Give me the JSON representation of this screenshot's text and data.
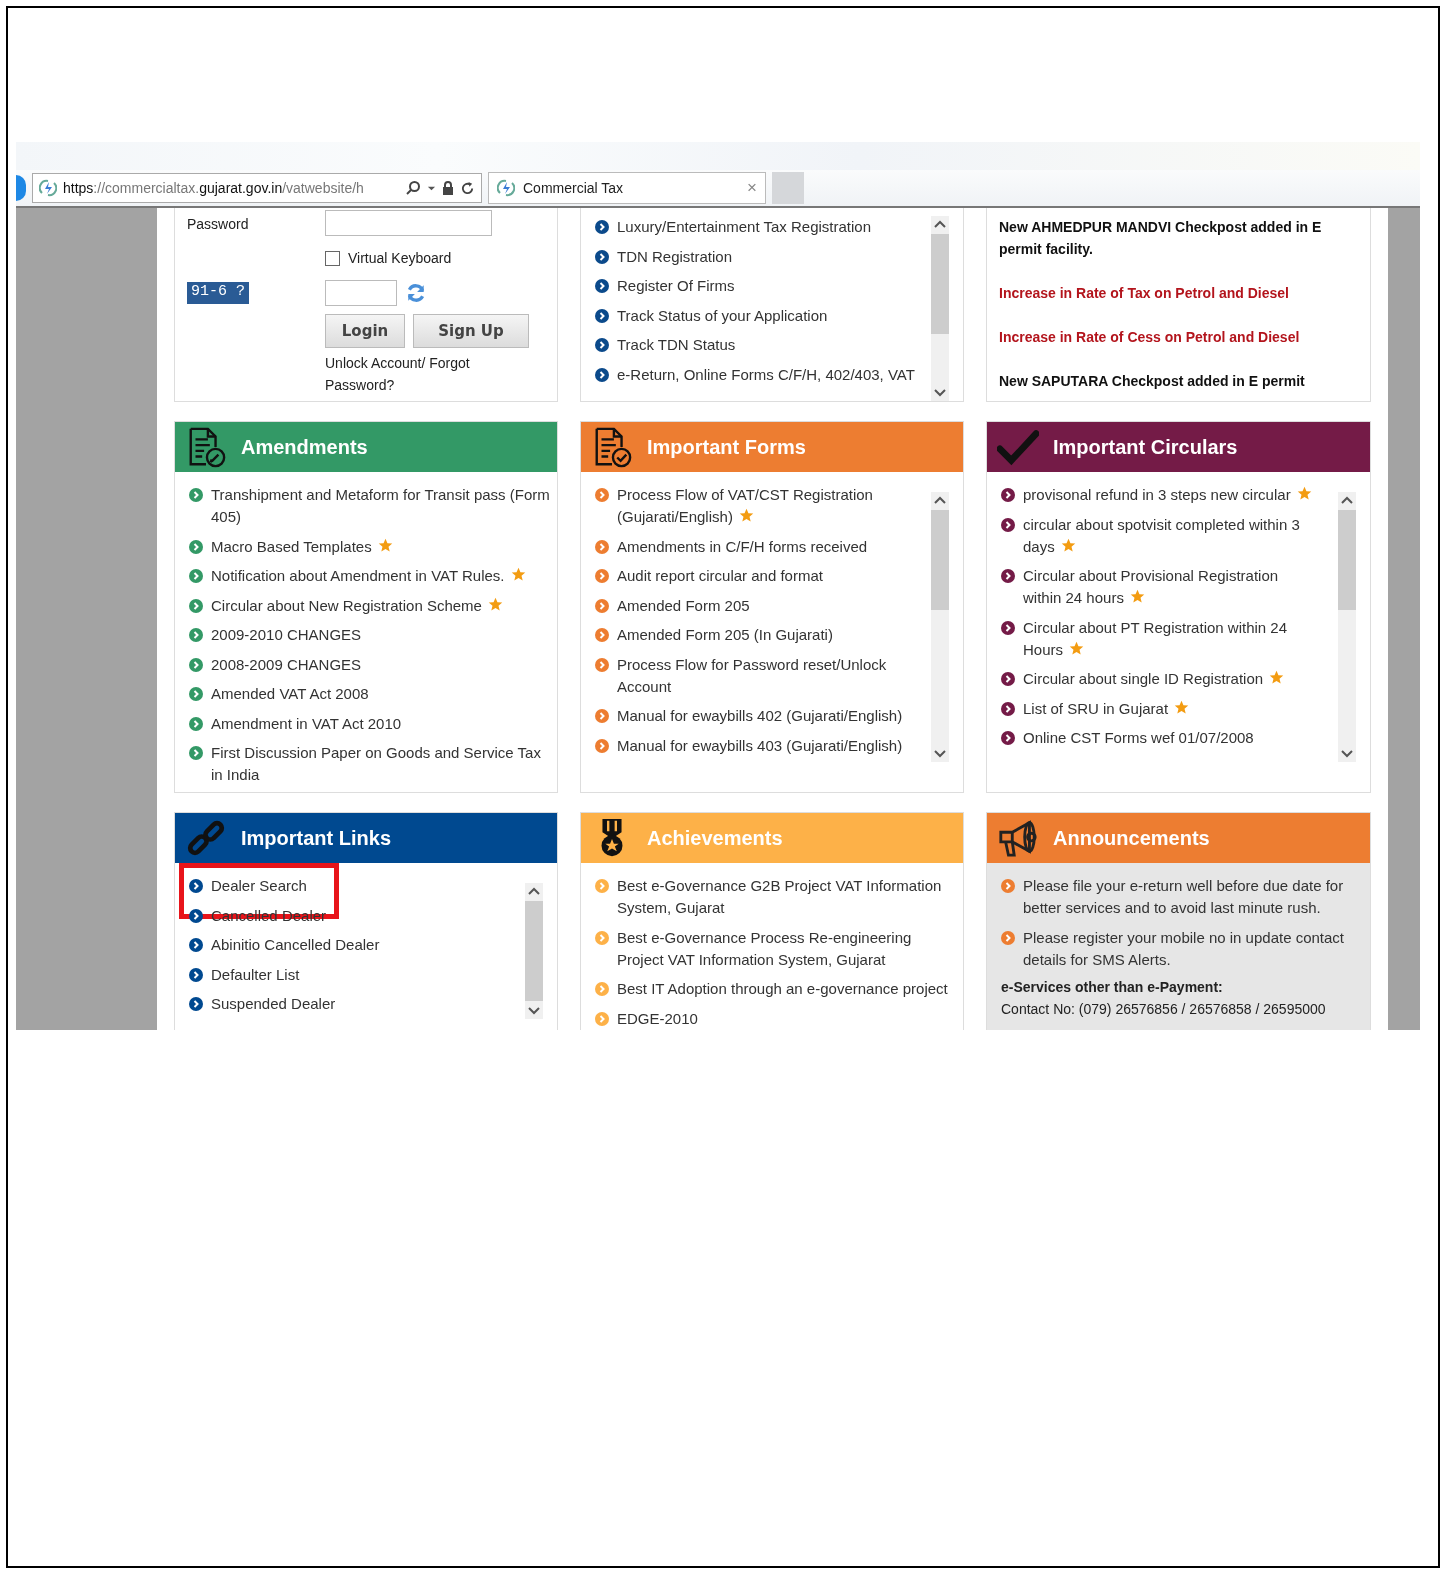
{
  "browser": {
    "url": {
      "scheme": "https",
      "prefix": "://commercialtax.",
      "domain": "gujarat.gov.in",
      "path": "/vatwebsite/h"
    },
    "tab": {
      "title": "Commercial Tax",
      "close": "×"
    }
  },
  "login": {
    "password_label": "Password",
    "virtual_keyboard": {
      "label": "Virtual Keyboard",
      "checked": false
    },
    "captcha": "91-6 ?",
    "buttons": [
      "Login",
      "Sign Up"
    ],
    "link": "Unlock Account/ Forgot Password?"
  },
  "services": {
    "scrollbar": true,
    "items": [
      {
        "text": "Luxury/Entertainment Tax Registration"
      },
      {
        "text": "TDN Registration"
      },
      {
        "text": "Register Of Firms"
      },
      {
        "text": "Track Status of your Application"
      },
      {
        "text": "Track TDN Status"
      },
      {
        "text": "e-Return, Online Forms C/F/H, 402/403, VAT"
      }
    ]
  },
  "news": [
    {
      "text": "New AHMEDPUR MANDVI Checkpost added in E permit facility.",
      "color": "#111111"
    },
    {
      "text": "Increase in Rate of Tax on Petrol and Diesel",
      "color": "#b3141c"
    },
    {
      "text": "Increase in Rate of Cess on Petrol and Diesel",
      "color": "#b3141c"
    },
    {
      "text": "New SAPUTARA Checkpost added in E permit",
      "color": "#111111"
    }
  ],
  "panels": [
    {
      "title": "Amendments",
      "color": "#339966",
      "scrollbar": false,
      "items": [
        {
          "text": "Transhipment and Metaform for Transit pass (Form 405)",
          "starred": false
        },
        {
          "text": "Macro Based Templates",
          "starred": true
        },
        {
          "text": "Notification about Amendment in VAT Rules.",
          "starred": true
        },
        {
          "text": "Circular about New Registration Scheme",
          "starred": true
        },
        {
          "text": "2009-2010 CHANGES",
          "starred": false
        },
        {
          "text": "2008-2009 CHANGES",
          "starred": false
        },
        {
          "text": "Amended VAT Act 2008",
          "starred": false
        },
        {
          "text": "Amendment in VAT Act 2010",
          "starred": false
        },
        {
          "text": "First Discussion Paper on Goods and Service Tax in India",
          "starred": false
        }
      ]
    },
    {
      "title": "Important Forms",
      "color": "#ed7d31",
      "scrollbar": true,
      "items": [
        {
          "text": "Process Flow of VAT/CST Registration (Gujarati/English)",
          "starred": true
        },
        {
          "text": "Amendments in C/F/H forms received",
          "starred": false
        },
        {
          "text": "Audit report circular and format",
          "starred": false
        },
        {
          "text": "Amended Form 205",
          "starred": false
        },
        {
          "text": "Amended Form 205 (In Gujarati)",
          "starred": false
        },
        {
          "text": "Process Flow for Password reset/Unlock Account",
          "starred": false
        },
        {
          "text": "Manual for ewaybills 402 (Gujarati/English)",
          "starred": false
        },
        {
          "text": "Manual for ewaybills 403 (Gujarati/English)",
          "starred": false
        }
      ]
    },
    {
      "title": "Important Circulars",
      "color": "#741b47",
      "scrollbar": true,
      "items": [
        {
          "text": "provisonal refund in 3 steps new circular",
          "starred": true
        },
        {
          "text": "circular about spotvisit completed within 3 days",
          "starred": true
        },
        {
          "text": "Circular about Provisional Registration within 24 hours",
          "starred": true
        },
        {
          "text": "Circular about PT Registration within 24 Hours",
          "starred": true
        },
        {
          "text": "Circular about single ID Registration",
          "starred": true
        },
        {
          "text": "List of SRU in Gujarat",
          "starred": true
        },
        {
          "text": "Online CST Forms wef 01/07/2008",
          "starred": false
        }
      ]
    },
    {
      "title": "Important Links",
      "color": "#004990",
      "scrollbar": true,
      "items": [
        {
          "text": "Dealer Search",
          "highlighted": true
        },
        {
          "text": "Cancelled Dealer",
          "highlighted": false
        },
        {
          "text": "Abinitio Cancelled Dealer",
          "highlighted": false
        },
        {
          "text": "Defaulter List",
          "highlighted": false
        },
        {
          "text": "Suspended Dealer",
          "highlighted": false
        }
      ]
    },
    {
      "title": "Achievements",
      "color": "#fdb148",
      "scrollbar": false,
      "items": [
        {
          "text": "Best e-Governance G2B Project VAT Information System, Gujarat"
        },
        {
          "text": "Best e-Governance Process Re-engineering Project VAT Information System, Gujarat"
        },
        {
          "text": "Best IT Adoption through an e-governance project"
        },
        {
          "text": "EDGE-2010"
        }
      ]
    },
    {
      "title": "Announcements",
      "color": "#ed7d31",
      "scrollbar": false,
      "items": [
        {
          "text": "Please file your e-return well before due date for better services and to avoid last minute rush."
        },
        {
          "text": "Please register your mobile no in update contact details for SMS Alerts."
        }
      ],
      "contact": {
        "heading": "e-Services other than e-Payment:",
        "line": "Contact No: (079) 26576856 / 26576858 / 26595000"
      }
    }
  ]
}
